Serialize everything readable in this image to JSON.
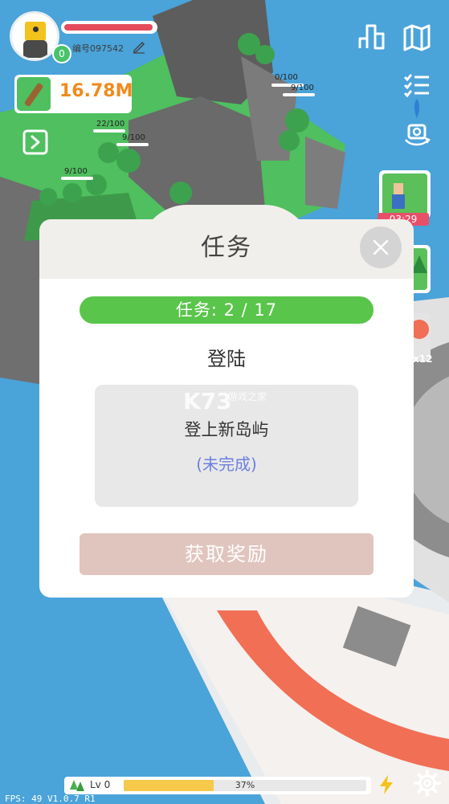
{
  "player": {
    "id_label": "编号097542",
    "level_badge": "0"
  },
  "resources": {
    "wood_value": "16.78M"
  },
  "world_labels": [
    {
      "text": "0/100"
    },
    {
      "text": "9/100"
    },
    {
      "text": "22/100"
    },
    {
      "text": "9/100"
    },
    {
      "text": "9/100"
    }
  ],
  "side_panel": {
    "timer": "03:29",
    "count": "x12"
  },
  "modal": {
    "title": "任务",
    "progress": "任务: 2 / 17",
    "task_name": "登陆",
    "task_desc": "登上新岛屿",
    "task_status": "(未完成)",
    "reward_button": "获取奖励",
    "watermark": "K73",
    "watermark_sub": "游戏之家"
  },
  "bottom": {
    "level_label": "Lv 0",
    "xp_percent_label": "37%",
    "xp_fraction": 0.37,
    "fps_text": "FPS: 49   V1.0.7  R1"
  },
  "colors": {
    "accent_green": "#59c54a",
    "hp_red": "#e44b5b",
    "wood_orange": "#f08a1c",
    "status_blue": "#6d7fe0"
  },
  "icons": [
    "leaderboard-icon",
    "map-icon",
    "task-list-icon",
    "camera-rotate-icon",
    "close-icon",
    "bolt-icon",
    "gear-icon",
    "edit-icon",
    "expand-icon",
    "tree-icon"
  ]
}
